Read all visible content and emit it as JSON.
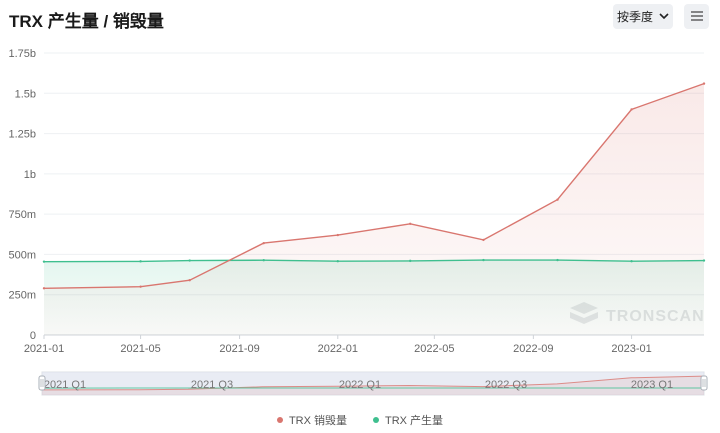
{
  "page": {
    "title": "TRX 产生量 / 销毁量",
    "period_select": "按季度",
    "watermark": "TRONSCAN"
  },
  "colors": {
    "burn": "#d9766f",
    "production": "#3fbf8f",
    "grid": "#eef0f3",
    "axis_text": "#666666"
  },
  "chart_data": {
    "type": "line",
    "title": "TRX 产生量 / 销毁量",
    "x_tick_labels": [
      "2021-01",
      "2021-05",
      "2021-09",
      "2022-01",
      "2022-05",
      "2022-09",
      "2023-01"
    ],
    "y_tick_labels": [
      "0",
      "250m",
      "500m",
      "750m",
      "1b",
      "1.25b",
      "1.5b",
      "1.75b"
    ],
    "ylim": [
      0,
      1.75
    ],
    "y_unit": "b",
    "grid": true,
    "legend_position": "bottom",
    "x": [
      "2021-01",
      "2021-05",
      "2021-07",
      "2021-10",
      "2022-01",
      "2022-04",
      "2022-07",
      "2022-10",
      "2023-01",
      "2023-04"
    ],
    "series": [
      {
        "name": "TRX 销毁量",
        "color": "#d9766f",
        "values": [
          0.29,
          0.3,
          0.34,
          0.57,
          0.62,
          0.69,
          0.59,
          0.84,
          1.4,
          1.56
        ]
      },
      {
        "name": "TRX 产生量",
        "color": "#3fbf8f",
        "values": [
          0.455,
          0.457,
          0.462,
          0.464,
          0.458,
          0.46,
          0.465,
          0.465,
          0.458,
          0.462
        ]
      }
    ],
    "zoom_slider": {
      "labels": [
        "2021 Q1",
        "2021 Q3",
        "2022 Q1",
        "2022 Q3",
        "2023 Q1"
      ],
      "range": [
        "2021-01",
        "2023-04"
      ]
    }
  }
}
